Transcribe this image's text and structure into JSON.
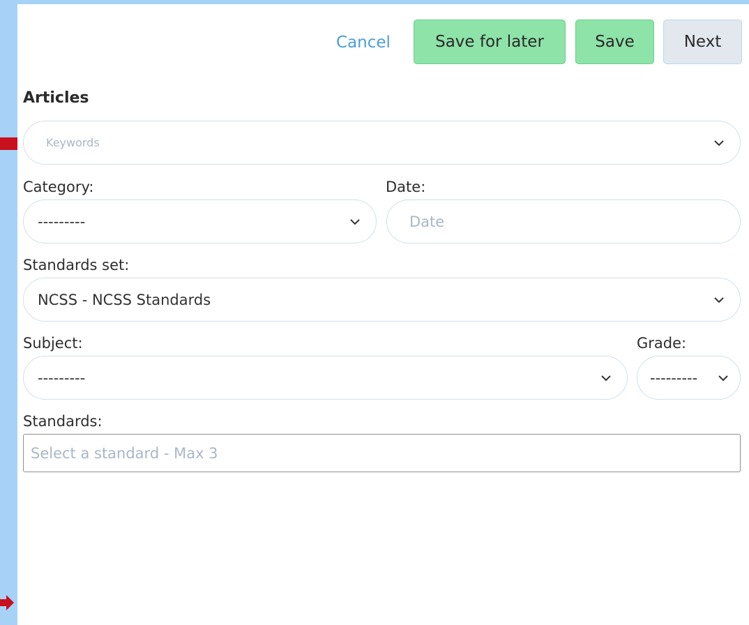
{
  "toolbar": {
    "cancel_label": "Cancel",
    "save_later_label": "Save for later",
    "save_label": "Save",
    "next_label": "Next"
  },
  "form": {
    "section_title": "Articles",
    "keywords": {
      "placeholder": "Keywords"
    },
    "category": {
      "label": "Category:",
      "value": "---------"
    },
    "date": {
      "label": "Date:",
      "placeholder": "Date"
    },
    "standards_set": {
      "label": "Standards set:",
      "value": "NCSS - NCSS Standards"
    },
    "subject": {
      "label": "Subject:",
      "value": "---------"
    },
    "grade": {
      "label": "Grade:",
      "value": "---------"
    },
    "standards": {
      "label": "Standards:",
      "placeholder": "Select a standard - Max 3"
    }
  },
  "colors": {
    "background": "#a7d2f7",
    "button_green": "#8ee3a8",
    "button_next": "#e3e8ef",
    "cancel_link": "#4a9fd8",
    "arrow_red": "#c8101e"
  },
  "icons": {
    "dropdown": "chevron-down-icon",
    "annotation": "red-arrow-icon"
  }
}
